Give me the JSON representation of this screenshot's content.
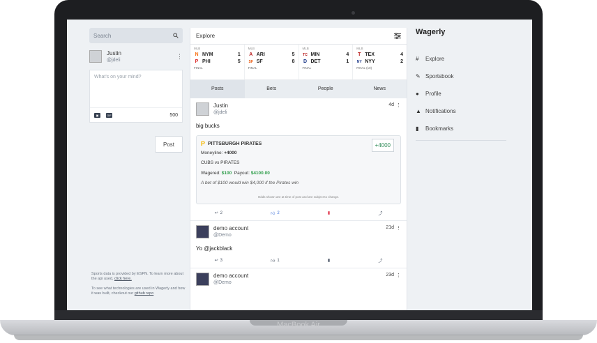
{
  "device": {
    "brand": "MacBook Air"
  },
  "left": {
    "search_placeholder": "Search",
    "user": {
      "name": "Justin",
      "handle": "@jdeli"
    },
    "composer": {
      "placeholder": "What's on your mind?",
      "count": "500",
      "gif_label": "GIF"
    },
    "post_button": "Post",
    "footnote1": "Sports data is provided by ESPN. To learn more about the api used, ",
    "footnote1_link": "click here.",
    "footnote2": "To see what technologies are used in Wagerly and how it was built, checkout our ",
    "footnote2_link": "github repo"
  },
  "center": {
    "title": "Explore",
    "scores": [
      {
        "league": "MLB",
        "t1": "NYM",
        "s1": "1",
        "t2": "PHI",
        "s2": "5",
        "status": "FINAL",
        "l1": "N",
        "l2": "P",
        "c1": "#f97316",
        "c2": "#dc2626"
      },
      {
        "league": "MLB",
        "t1": "ARI",
        "s1": "5",
        "t2": "SF",
        "s2": "8",
        "status": "FINAL",
        "l1": "A",
        "l2": "SF",
        "c1": "#b91c1c",
        "c2": "#ea580c"
      },
      {
        "league": "MLB",
        "t1": "MIN",
        "s1": "4",
        "t2": "DET",
        "s2": "1",
        "status": "FINAL",
        "l1": "TC",
        "l2": "D",
        "c1": "#b91c1c",
        "c2": "#1e3a8a"
      },
      {
        "league": "MLB",
        "t1": "TEX",
        "s1": "4",
        "t2": "NYY",
        "s2": "2",
        "status": "FINAL (10)",
        "l1": "T",
        "l2": "NY",
        "c1": "#b91c1c",
        "c2": "#1e3a8a"
      }
    ],
    "tabs": [
      "Posts",
      "Bets",
      "People",
      "News"
    ],
    "posts": [
      {
        "name": "Justin",
        "handle": "@jdeli",
        "time": "4d",
        "text": "big bucks",
        "bet": {
          "team": "PITTSBURGH PIRATES",
          "odds": "+4000",
          "moneyline_label": "Moneyline: ",
          "moneyline": "+4000",
          "matchup": "CUBS vs PIRATES",
          "wagered_label": "Wagered: ",
          "wagered": "$100",
          "payout_label": "Payout: ",
          "payout": "$4100.00",
          "note": "A bet of $100 would win $4,000 if the Pirates win",
          "disclaimer": "Odds shown are at time of post and are subject to change."
        },
        "replies": "2",
        "likes": "2"
      },
      {
        "name": "demo account",
        "handle": "@Demo",
        "time": "21d",
        "text": "Yo @jackblack",
        "replies": "3",
        "likes": "1"
      },
      {
        "name": "demo account",
        "handle": "@Demo",
        "time": "23d",
        "text": ""
      }
    ]
  },
  "right": {
    "app_name": "Wagerly",
    "nav": [
      {
        "label": "Explore",
        "icon": "hash-icon"
      },
      {
        "label": "Sportsbook",
        "icon": "pen-icon"
      },
      {
        "label": "Profile",
        "icon": "user-icon"
      },
      {
        "label": "Notifications",
        "icon": "bell-icon"
      },
      {
        "label": "Bookmarks",
        "icon": "bookmark-icon"
      }
    ]
  },
  "colors": {
    "accent_green": "#2e9d4a",
    "bookmark_red": "#e0344b",
    "like_blue": "#3b6fd8"
  }
}
